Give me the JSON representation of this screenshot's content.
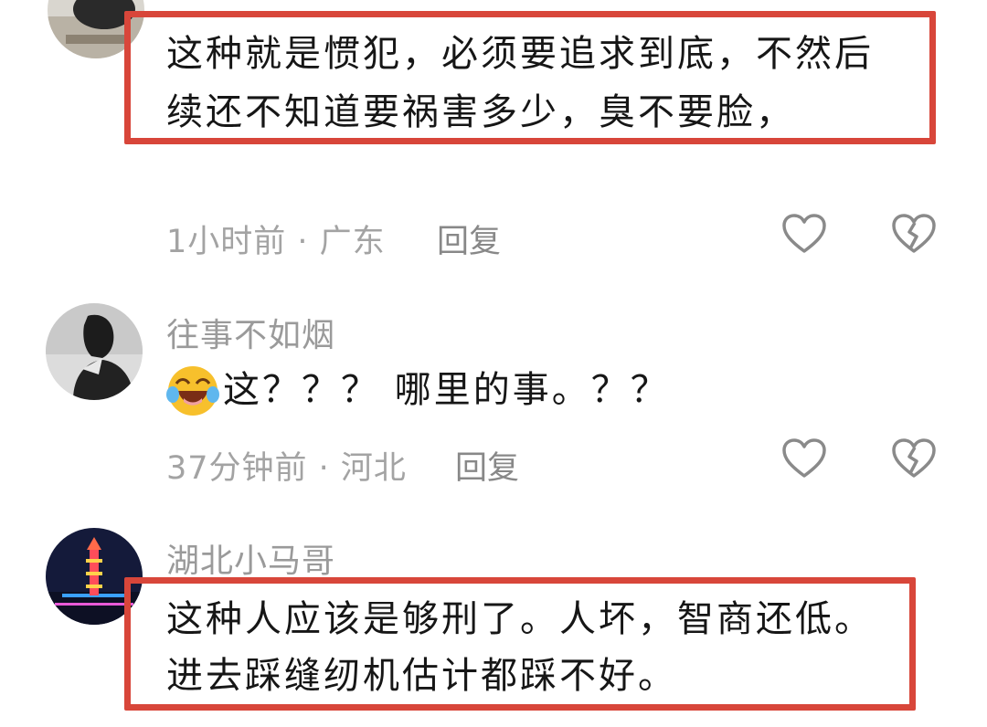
{
  "colors": {
    "highlight_red": "#d8463a",
    "username_gray": "#9a9a9a",
    "meta_gray": "#a3a3a3",
    "text_dark": "#161616"
  },
  "comments": [
    {
      "username": "",
      "lines": [
        "这种就是惯犯，必须要追求到底，不然后",
        "续还不知道要祸害多少，臭不要脸，"
      ],
      "meta": "1小时前 · 广东",
      "reply_label": "回复",
      "like_icon": "heart-outline-icon",
      "dislike_icon": "broken-heart-icon"
    },
    {
      "username": "往事不如烟",
      "emoji_icon": "laughing-crying-emoji-icon",
      "lines": [
        "这？？？ 哪里的事。？？"
      ],
      "meta": "37分钟前 · 河北",
      "reply_label": "回复",
      "like_icon": "heart-outline-icon",
      "dislike_icon": "broken-heart-icon"
    },
    {
      "username": "湖北小马哥",
      "lines": [
        "这种人应该是够刑了。人坏，智商还低。",
        "进去踩缝纫机估计都踩不好。"
      ],
      "meta": "",
      "reply_label": "",
      "like_icon": "heart-outline-icon",
      "dislike_icon": "broken-heart-icon"
    }
  ]
}
